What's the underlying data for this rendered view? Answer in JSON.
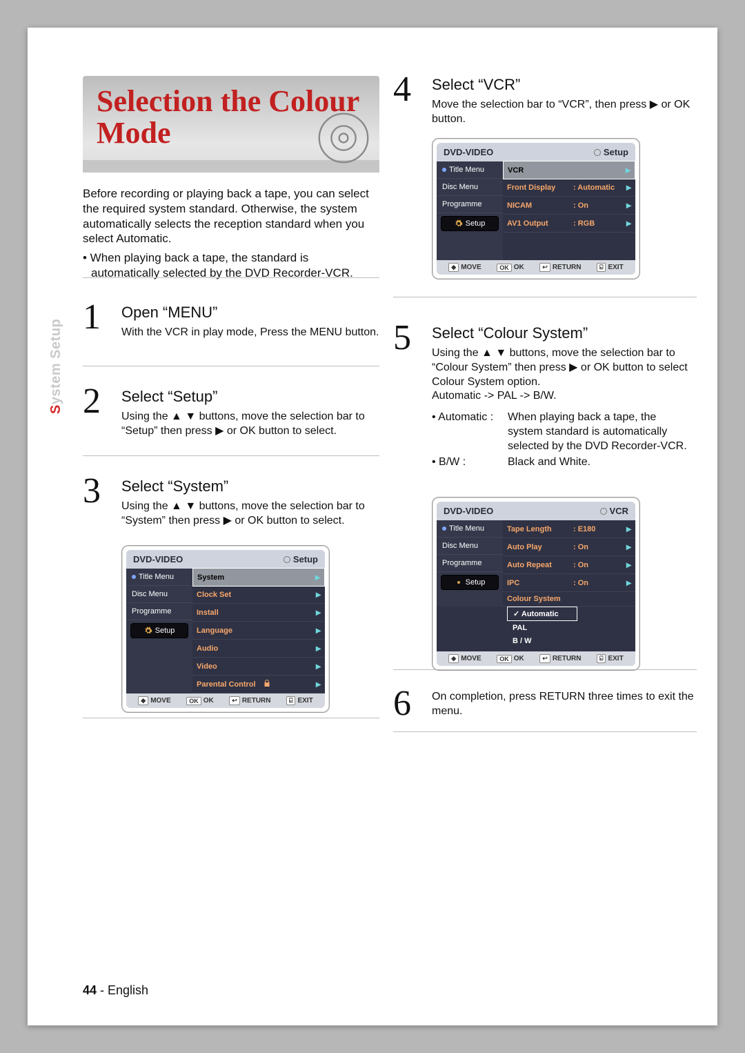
{
  "side_tab": {
    "prefix": "S",
    "rest": "ystem Setup"
  },
  "banner": {
    "title": "Selection the Colour\nMode"
  },
  "intro": {
    "para": "Before recording  or playing back a tape, you can select the required system standard. Otherwise, the system automatically selects the reception standard when you select Automatic.",
    "bullet": "• When playing back a tape, the standard is automatically selected by the DVD Recorder-VCR."
  },
  "steps": {
    "s1": {
      "num": "1",
      "title": "Open “MENU”",
      "text": "With the VCR in play mode, Press the MENU button."
    },
    "s2": {
      "num": "2",
      "title": "Select “Setup”",
      "text": "Using the ▲ ▼ buttons, move the selection bar to “Setup” then press ▶ or OK button to select."
    },
    "s3": {
      "num": "3",
      "title": "Select “System”",
      "text": "Using the ▲ ▼ buttons, move the selection bar to “System” then press ▶ or OK button to select."
    },
    "s4": {
      "num": "4",
      "title": "Select “VCR”",
      "text": "Move the selection bar to “VCR”, then press ▶ or OK button."
    },
    "s5": {
      "num": "5",
      "title": "Select “Colour System”",
      "text": "Using the ▲ ▼ buttons, move the selection bar to “Colour System” then press ▶ or OK button to select Colour System option.\nAutomatic -> PAL -> B/W.",
      "defs": {
        "auto_k": "• Automatic :",
        "auto_v": "When playing back a tape, the system standard is automatically selected by the DVD Recorder-VCR.",
        "bw_k": "• B/W :",
        "bw_v": "Black and White."
      }
    },
    "s6": {
      "num": "6",
      "text": "On completion, press RETURN three times to exit the menu."
    }
  },
  "osd": {
    "common": {
      "title": "DVD-VIDEO",
      "head_right_setup": "Setup",
      "head_right_vcr": "VCR",
      "nav": {
        "title_menu": "Title Menu",
        "disc_menu": "Disc Menu",
        "programme": "Programme",
        "setup": "Setup"
      },
      "footer": {
        "move": "MOVE",
        "ok": "OK",
        "return": "RETURN",
        "exit": "EXIT"
      }
    },
    "panel3": {
      "header_row": "System",
      "rows": [
        {
          "k": "Clock Set"
        },
        {
          "k": "Install"
        },
        {
          "k": "Language"
        },
        {
          "k": "Audio"
        },
        {
          "k": "Video"
        },
        {
          "k": "Parental Control",
          "lock": true
        }
      ]
    },
    "panel4": {
      "header_row": "VCR",
      "rows": [
        {
          "k": "Front Display",
          "v": ": Automatic"
        },
        {
          "k": "NICAM",
          "v": ": On"
        },
        {
          "k": "AV1 Output",
          "v": ": RGB"
        }
      ]
    },
    "panel5": {
      "rows": [
        {
          "k": "Tape Length",
          "v": ": E180"
        },
        {
          "k": "Auto Play",
          "v": ": On"
        },
        {
          "k": "Auto Repeat",
          "v": ": On"
        },
        {
          "k": "IPC",
          "v": ": On"
        },
        {
          "k": "Colour System"
        }
      ],
      "options": [
        {
          "label": "Automatic",
          "sel": true
        },
        {
          "label": "PAL"
        },
        {
          "label": "B / W"
        }
      ]
    }
  },
  "footer": {
    "page": "44",
    "sep": " - ",
    "lang": "English"
  }
}
